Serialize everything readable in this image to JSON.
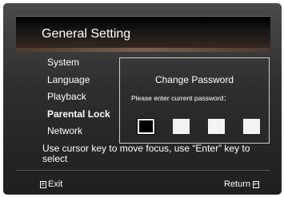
{
  "header": {
    "title": "General Setting"
  },
  "menu": {
    "items": [
      {
        "label": "System"
      },
      {
        "label": "Language"
      },
      {
        "label": "Playback"
      },
      {
        "label": "Parental Lock"
      },
      {
        "label": "Network"
      }
    ],
    "active_index": 3
  },
  "dialog": {
    "title": "Change Password",
    "prompt": "Please enter current password：",
    "password_boxes": 4,
    "focused_box": 0
  },
  "help": {
    "text": "Use cursor key to move focus, use  “Enter”  key to select"
  },
  "footer": {
    "exit_label": "Exit",
    "exit_icon": "exit-key-icon",
    "return_label": "Return",
    "return_icon": "return-key-icon"
  }
}
